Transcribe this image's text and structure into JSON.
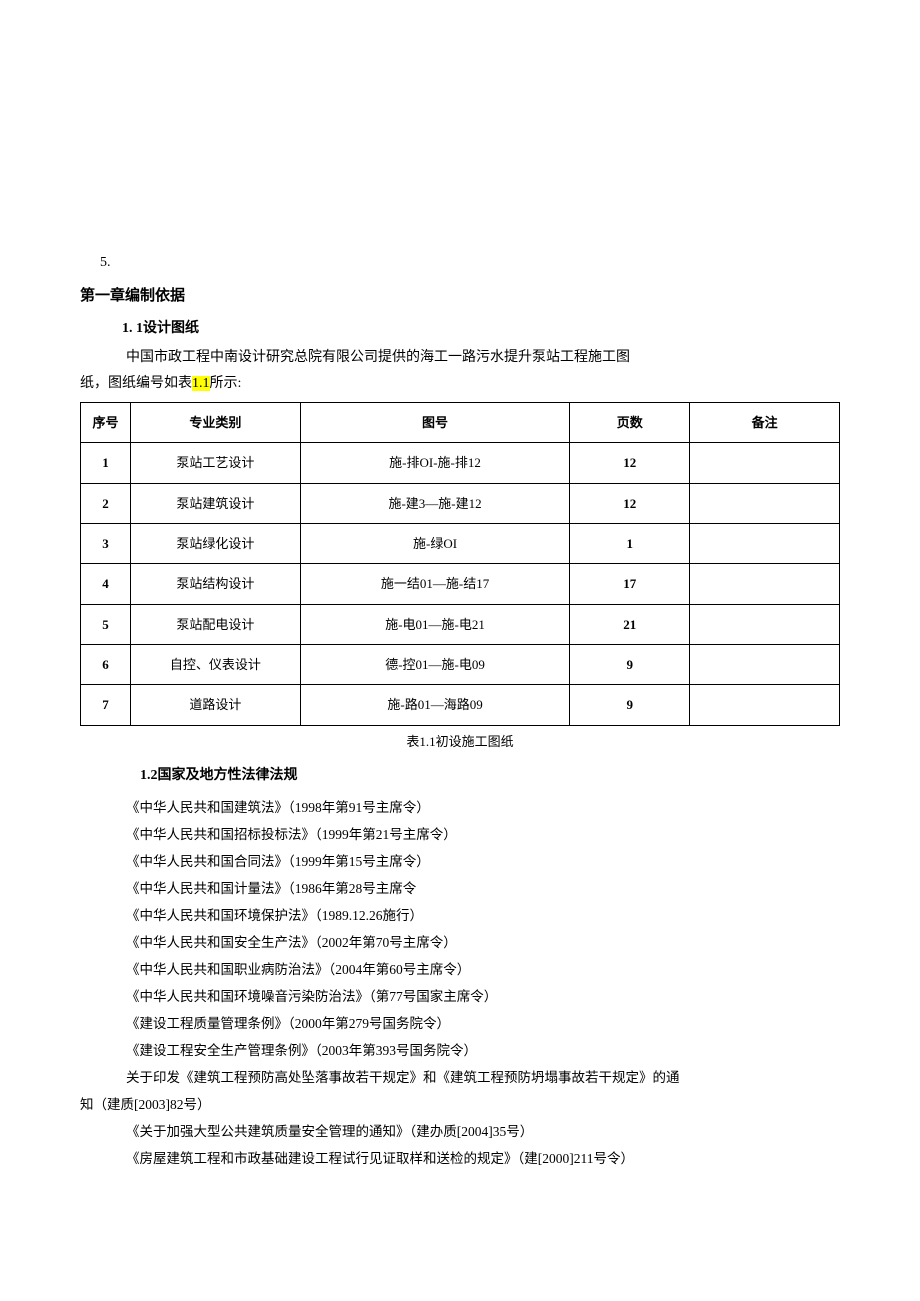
{
  "list_num": "5.",
  "chapter_title": "第一章编制依据",
  "section_1_1_title": "1.   1设计图纸",
  "section_1_1_para1": "中国市政工程中南设计研究总院有限公司提供的海工一路污水提升泵站工程施工图",
  "section_1_1_para2_pre": "纸，图纸编号如表",
  "section_1_1_highlight": "1.1",
  "section_1_1_para2_post": "所示:",
  "table": {
    "headers": [
      "序号",
      "专业类别",
      "图号",
      "页数",
      "备注"
    ],
    "rows": [
      {
        "seq": "1",
        "cat": "泵站工艺设计",
        "num": "施-排OI-施-排12",
        "page": "12",
        "note": ""
      },
      {
        "seq": "2",
        "cat": "泵站建筑设计",
        "num": "施-建3—施-建12",
        "page": "12",
        "note": ""
      },
      {
        "seq": "3",
        "cat": "泵站绿化设计",
        "num": "施-绿OI",
        "page": "1",
        "note": ""
      },
      {
        "seq": "4",
        "cat": "泵站结构设计",
        "num": "施一结01—施-结17",
        "page": "17",
        "note": ""
      },
      {
        "seq": "5",
        "cat": "泵站配电设计",
        "num": "施-电01—施-电21",
        "page": "21",
        "note": ""
      },
      {
        "seq": "6",
        "cat": "自控、仪表设计",
        "num": "德-控01—施-电09",
        "page": "9",
        "note": ""
      },
      {
        "seq": "7",
        "cat": "道路设计",
        "num": "施-路01—海路09",
        "page": "9",
        "note": ""
      }
    ],
    "caption": "表1.1初设施工图纸"
  },
  "section_1_2_title": "1.2国家及地方性法律法规",
  "laws": [
    "《中华人民共和国建筑法》（1998年第91号主席令）",
    "《中华人民共和国招标投标法》（1999年第21号主席令）",
    "《中华人民共和国合同法》（1999年第15号主席令）",
    "《中华人民共和国计量法》（1986年第28号主席令",
    "《中华人民共和国环境保护法》（1989.12.26施行）",
    "《中华人民共和国安全生产法》（2002年第70号主席令）",
    "《中华人民共和国职业病防治法》（2004年第60号主席令）",
    "《中华人民共和国环境噪音污染防治法》（第77号国家主席令）",
    "《建设工程质量管理条例》（2000年第279号国务院令）",
    "《建设工程安全生产管理条例》（2003年第393号国务院令）"
  ],
  "law_wrap_line1": "关于印发《建筑工程预防高处坠落事故若干规定》和《建筑工程预防坍塌事故若干规定》的通",
  "law_wrap_line2": "知（建质[2003]82号）",
  "laws_after": [
    "《关于加强大型公共建筑质量安全管理的通知》（建办质[2004]35号）",
    "《房屋建筑工程和市政基础建设工程试行见证取样和送检的规定》（建[2000]211号令）"
  ]
}
